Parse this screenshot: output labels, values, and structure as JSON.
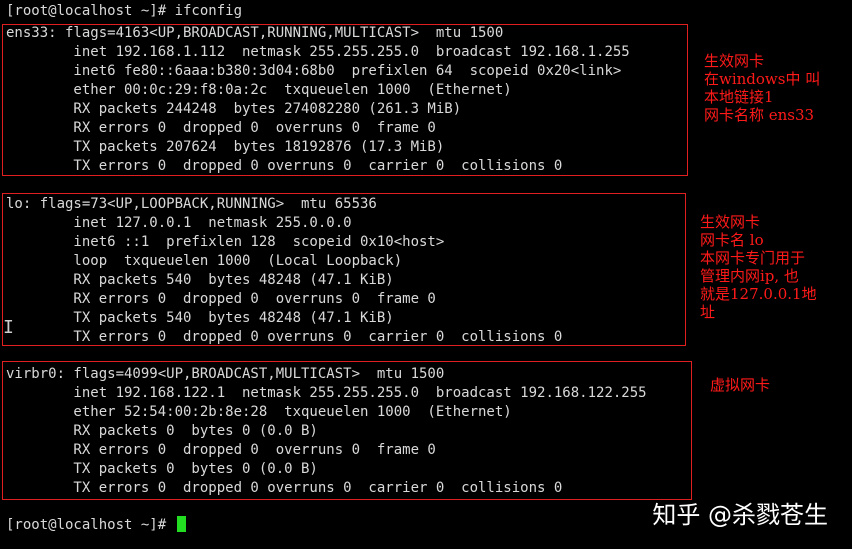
{
  "prompt": {
    "first": "[root@localhost ~]# ifconfig",
    "last": "[root@localhost ~]# "
  },
  "interfaces": [
    {
      "lines": [
        "ens33: flags=4163<UP,BROADCAST,RUNNING,MULTICAST>  mtu 1500",
        "        inet 192.168.1.112  netmask 255.255.255.0  broadcast 192.168.1.255",
        "        inet6 fe80::6aaa:b380:3d04:68b0  prefixlen 64  scopeid 0x20<link>",
        "        ether 00:0c:29:f8:0a:2c  txqueuelen 1000  (Ethernet)",
        "        RX packets 244248  bytes 274082280 (261.3 MiB)",
        "        RX errors 0  dropped 0  overruns 0  frame 0",
        "        TX packets 207624  bytes 18192876 (17.3 MiB)",
        "        TX errors 0  dropped 0 overruns 0  carrier 0  collisions 0"
      ],
      "note": "生效网卡\n在windows中 叫\n本地链接1\n网卡名称 ens33"
    },
    {
      "lines": [
        "lo: flags=73<UP,LOOPBACK,RUNNING>  mtu 65536",
        "        inet 127.0.0.1  netmask 255.0.0.0",
        "        inet6 ::1  prefixlen 128  scopeid 0x10<host>",
        "        loop  txqueuelen 1000  (Local Loopback)",
        "        RX packets 540  bytes 48248 (47.1 KiB)",
        "        RX errors 0  dropped 0  overruns 0  frame 0",
        "        TX packets 540  bytes 48248 (47.1 KiB)",
        "        TX errors 0  dropped 0 overruns 0  carrier 0  collisions 0"
      ],
      "note": "生效网卡\n网卡名 lo\n本网卡专门用于\n管理内网ip, 也\n就是127.0.0.1地\n址"
    },
    {
      "lines": [
        "virbr0: flags=4099<UP,BROADCAST,MULTICAST>  mtu 1500",
        "        inet 192.168.122.1  netmask 255.255.255.0  broadcast 192.168.122.255",
        "        ether 52:54:00:2b:8e:28  txqueuelen 1000  (Ethernet)",
        "        RX packets 0  bytes 0 (0.0 B)",
        "        RX errors 0  dropped 0  overruns 0  frame 0",
        "        TX packets 0  bytes 0 (0.0 B)",
        "        TX errors 0  dropped 0 overruns 0  carrier 0  collisions 0"
      ],
      "note": "虚拟网卡"
    }
  ],
  "watermark": "知乎 @杀戮苍生",
  "colors": {
    "background": "#000000",
    "text": "#d9d9d9",
    "annotation": "#ff1a1a",
    "cursor": "#22dd22"
  }
}
